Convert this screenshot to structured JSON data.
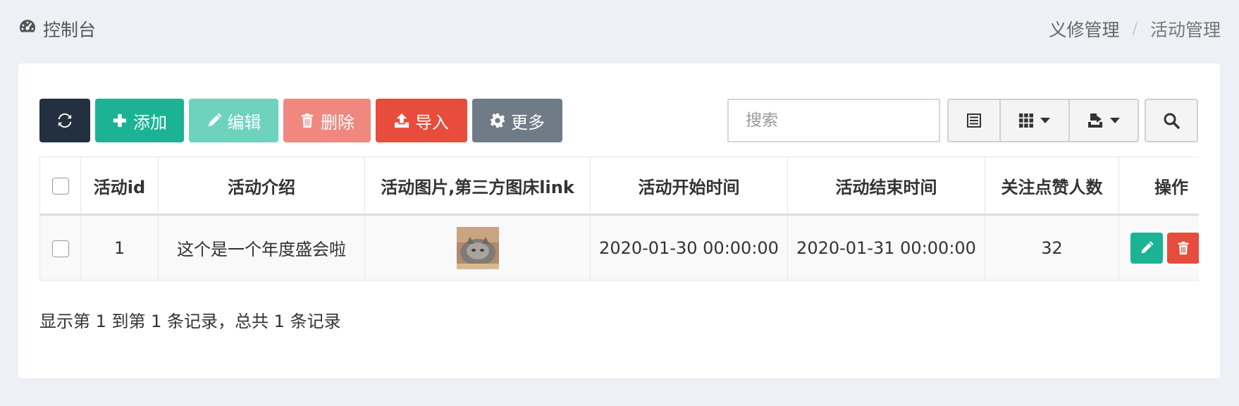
{
  "header": {
    "console_label": "控制台",
    "breadcrumb": [
      "义修管理",
      "活动管理"
    ],
    "breadcrumb_separator": "/"
  },
  "toolbar": {
    "add_label": "添加",
    "edit_label": "编辑",
    "delete_label": "删除",
    "import_label": "导入",
    "more_label": "更多"
  },
  "search": {
    "placeholder": "搜索"
  },
  "table": {
    "columns": [
      "活动id",
      "活动介绍",
      "活动图片,第三方图床link",
      "活动开始时间",
      "活动结束时间",
      "关注点赞人数",
      "操作"
    ],
    "rows": [
      {
        "id": "1",
        "intro": "这个是一个年度盛会啦",
        "start_time": "2020-01-30 00:00:00",
        "end_time": "2020-01-31 00:00:00",
        "likes": "32"
      }
    ]
  },
  "footer": {
    "info": "显示第 1 到第 1 条记录，总共 1 条记录"
  },
  "colors": {
    "dark": "#23303f",
    "primary": "#1bb394",
    "primary_light": "#6fd2bd",
    "danger_light": "#f08880",
    "danger": "#e74c3c",
    "gray": "#6f7c87"
  }
}
